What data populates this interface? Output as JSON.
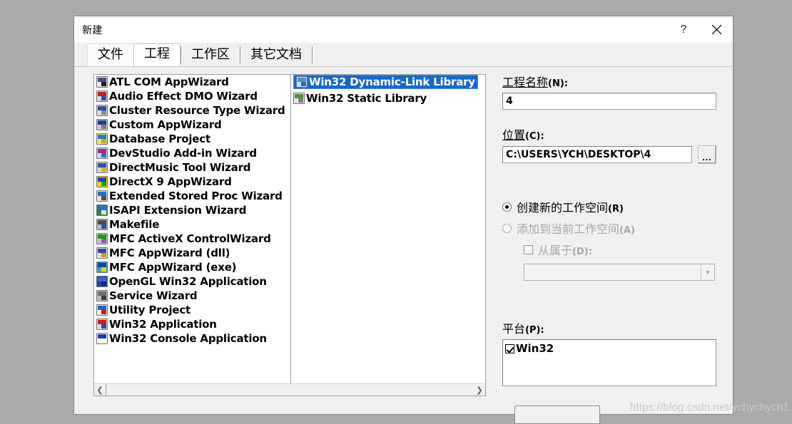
{
  "window": {
    "title": "新建",
    "help_button": "?",
    "close_button": "✕"
  },
  "tabs": [
    {
      "label": "文件",
      "selected": false
    },
    {
      "label": "工程",
      "selected": true
    },
    {
      "label": "工作区",
      "selected": false
    },
    {
      "label": "其它文档",
      "selected": false
    }
  ],
  "left_list": {
    "items": [
      {
        "label": "ATL COM AppWizard",
        "icon": "atl-com-appwizard-icon"
      },
      {
        "label": "Audio Effect DMO Wizard",
        "icon": "audio-effect-dmo-wizard-icon"
      },
      {
        "label": "Cluster Resource Type Wizard",
        "icon": "cluster-resource-type-wizard-icon"
      },
      {
        "label": "Custom AppWizard",
        "icon": "custom-appwizard-icon"
      },
      {
        "label": "Database Project",
        "icon": "database-project-icon"
      },
      {
        "label": "DevStudio Add-in Wizard",
        "icon": "devstudio-addin-wizard-icon"
      },
      {
        "label": "DirectMusic Tool Wizard",
        "icon": "directmusic-tool-wizard-icon"
      },
      {
        "label": "DirectX 9 AppWizard",
        "icon": "directx9-appwizard-icon"
      },
      {
        "label": "Extended Stored Proc Wizard",
        "icon": "extended-stored-proc-wizard-icon"
      },
      {
        "label": "ISAPI Extension Wizard",
        "icon": "isapi-extension-wizard-icon"
      },
      {
        "label": "Makefile",
        "icon": "makefile-icon"
      },
      {
        "label": "MFC ActiveX ControlWizard",
        "icon": "mfc-activex-controlwizard-icon"
      },
      {
        "label": "MFC AppWizard (dll)",
        "icon": "mfc-appwizard-dll-icon"
      },
      {
        "label": "MFC AppWizard (exe)",
        "icon": "mfc-appwizard-exe-icon"
      },
      {
        "label": "OpenGL Win32 Application",
        "icon": "opengl-win32-application-icon"
      },
      {
        "label": "Service Wizard",
        "icon": "service-wizard-icon"
      },
      {
        "label": "Utility Project",
        "icon": "utility-project-icon"
      },
      {
        "label": "Win32 Application",
        "icon": "win32-application-icon"
      },
      {
        "label": "Win32 Console Application",
        "icon": "win32-console-application-icon"
      }
    ],
    "scroll_left_arrow": "❮",
    "scroll_right_arrow": "❯"
  },
  "right_list": {
    "items": [
      {
        "label": "Win32 Dynamic-Link Library",
        "icon": "win32-dll-icon",
        "selected": true
      },
      {
        "label": "Win32 Static Library",
        "icon": "win32-static-library-icon",
        "selected": false
      }
    ]
  },
  "form": {
    "project_name": {
      "label": "工程名称",
      "mnemonic": "(N):",
      "value": "4"
    },
    "location": {
      "label": "位置",
      "mnemonic": "(C):",
      "value": "C:\\USERS\\YCH\\DESKTOP\\4",
      "browse_label": "..."
    },
    "workspace_options": {
      "create_new": {
        "label": "创建新的工作空间",
        "mnemonic": "(R)",
        "checked": true,
        "enabled": true
      },
      "add_current": {
        "label": "添加到当前工作空间",
        "mnemonic": "(A)",
        "checked": false,
        "enabled": false
      },
      "dependency": {
        "label": "从属于",
        "mnemonic": "(D):",
        "checked": false,
        "enabled": false
      },
      "dependency_combo_value": "",
      "combo_arrow": "▼"
    },
    "platform": {
      "label": "平台",
      "mnemonic": "(P):",
      "items": [
        {
          "label": "Win32",
          "checked": true
        }
      ]
    }
  },
  "watermark": "https://blog.csdn.net/ychychych1",
  "colors": {
    "selection_blue": "#1569c7",
    "dialog_bg": "#f0f0f0",
    "desktop_bg": "#aaaaaa"
  }
}
